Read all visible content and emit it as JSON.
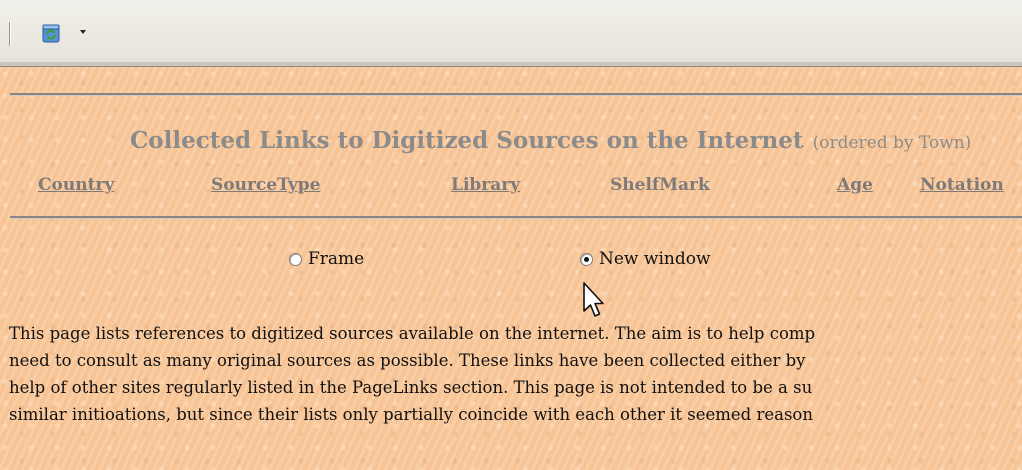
{
  "toolbar": {
    "icons": [
      "recycle-icon",
      "dropdown-arrow-icon"
    ]
  },
  "heading": {
    "title": "Collected Links to Digitized Sources on the Internet",
    "subtitle": "(ordered by Town)"
  },
  "columns": [
    {
      "label": "Country"
    },
    {
      "label": "SourceType"
    },
    {
      "label": "Library"
    },
    {
      "label": "ShelfMark"
    },
    {
      "label": "Age"
    },
    {
      "label": "Notation"
    }
  ],
  "radios": [
    {
      "label": "Frame",
      "checked": false
    },
    {
      "label": "New window",
      "checked": true
    }
  ],
  "paragraph": [
    "This page lists references to digitized sources available on the internet. The aim is to help comp",
    "need to consult as many original sources as possible. These links have been collected either by",
    "help of other sites regularly listed in the PageLinks section. This page is not intended to be a su",
    "similar initioations, but since their lists only partially coincide with each other it seemed reason"
  ],
  "colors": {
    "page_background": "#f9c79a",
    "heading_color": "#8b8b8b"
  }
}
